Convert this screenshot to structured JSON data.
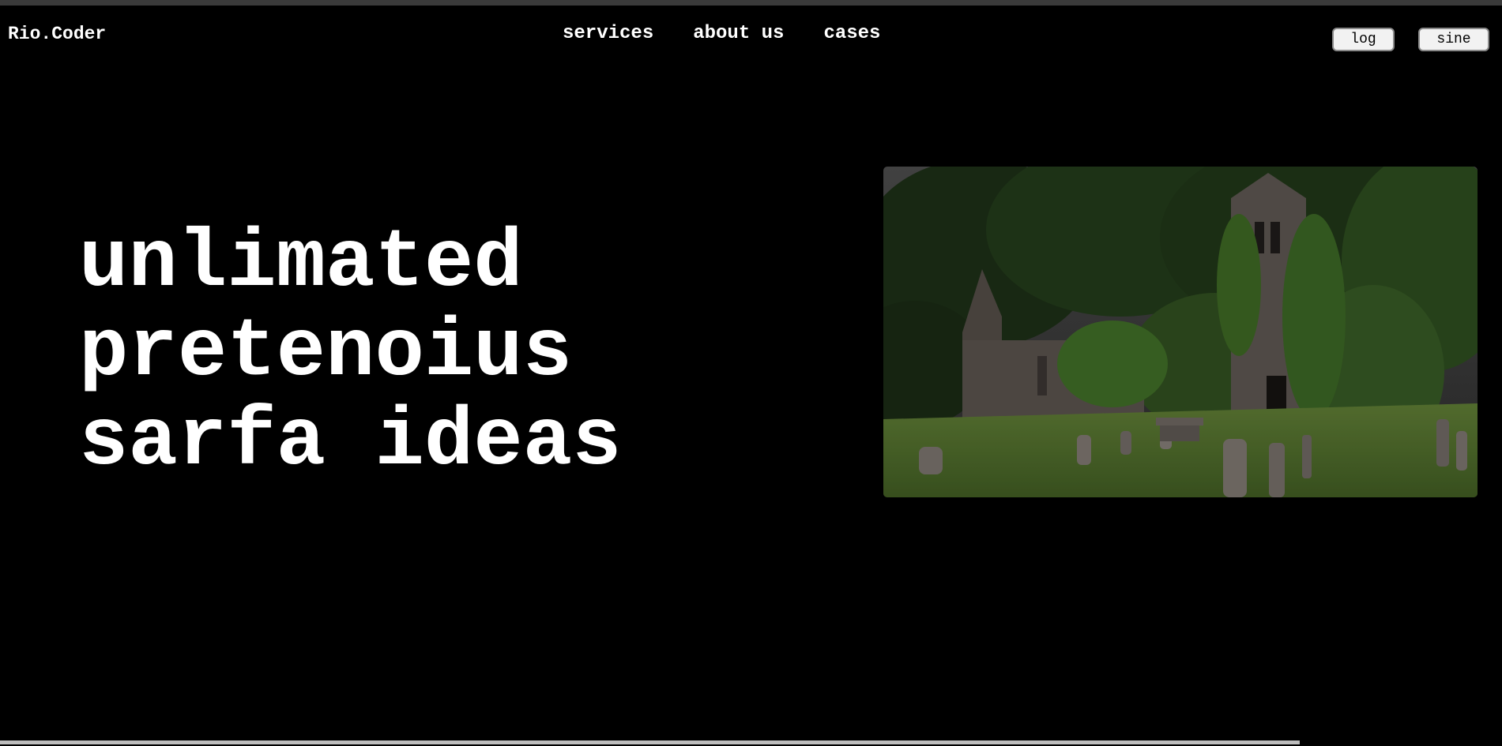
{
  "brand": {
    "name": "Rio.Coder"
  },
  "nav": {
    "links": [
      {
        "label": "services"
      },
      {
        "label": "about us"
      },
      {
        "label": "cases"
      }
    ]
  },
  "auth": {
    "login_label": "log in",
    "signup_label": "sine up"
  },
  "hero": {
    "title_lines": [
      "unlimated",
      "pretenoius",
      "sarfa ideas"
    ],
    "image": {
      "icon": "church-ruins-photo"
    }
  },
  "colors": {
    "background": "#000000",
    "text": "#ffffff",
    "button_bg": "#f2f2f2"
  }
}
